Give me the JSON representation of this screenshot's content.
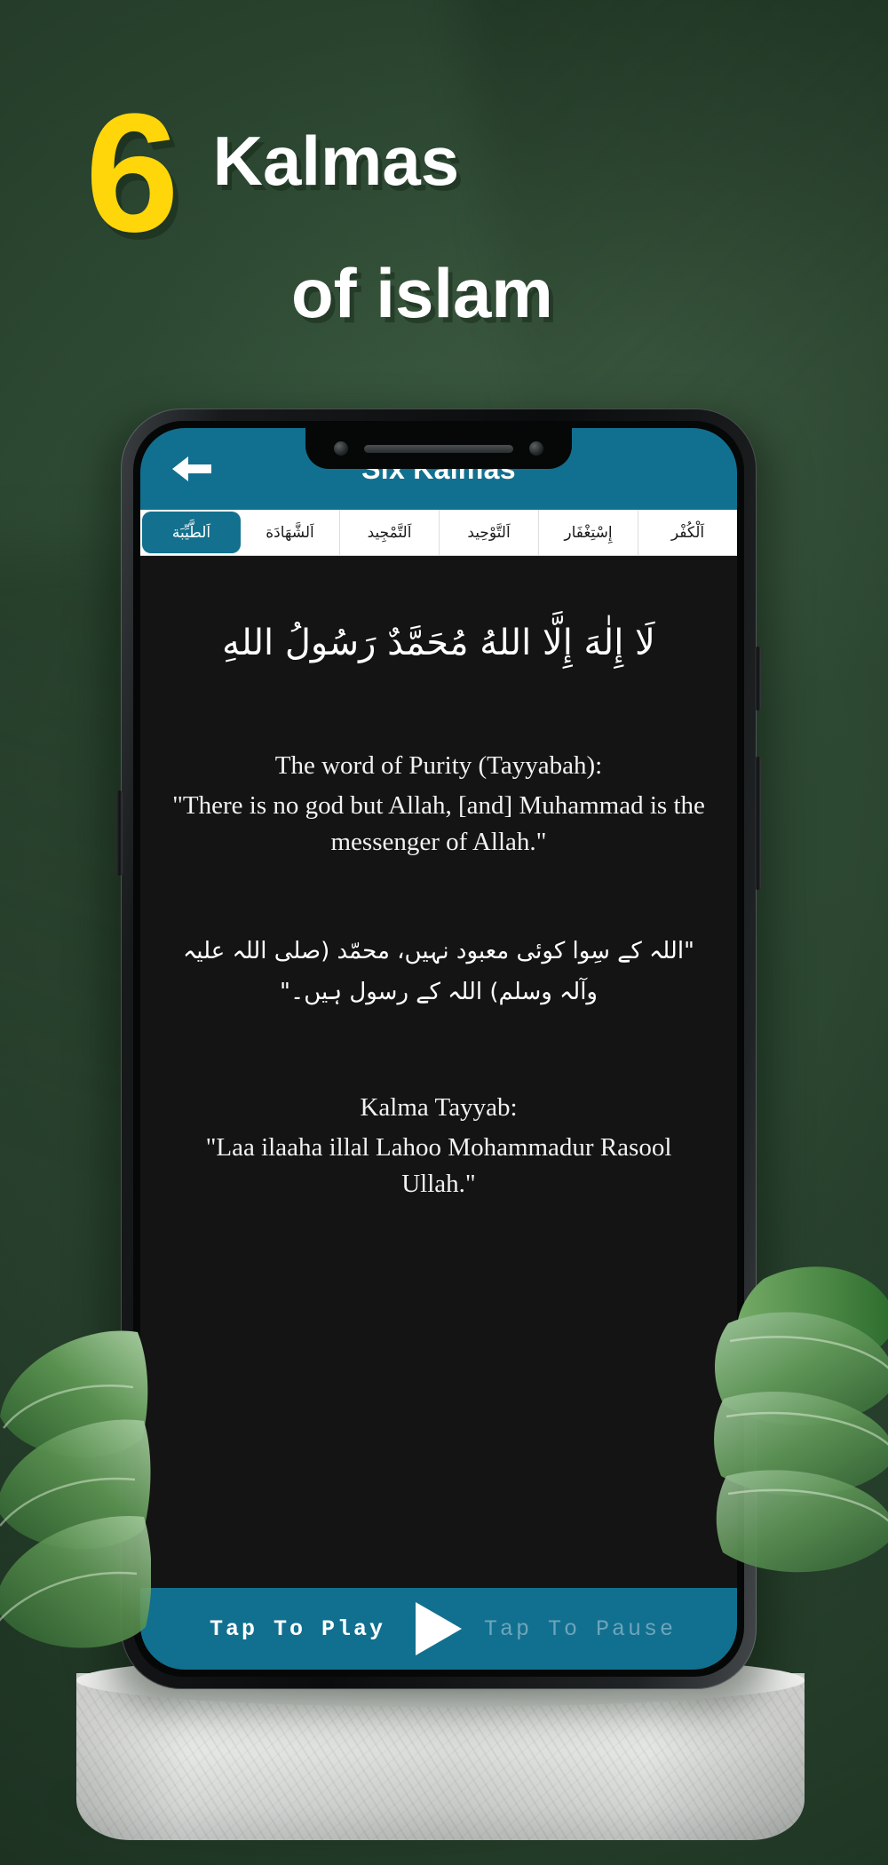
{
  "poster": {
    "big_number": "6",
    "title_line1": "Kalmas",
    "title_line2": "of islam",
    "number_color": "#FFD60A",
    "title_color": "#FFFFFF",
    "background_color": "#2F4A35"
  },
  "app": {
    "accent_color": "#11708F",
    "screen_background": "#141414",
    "appbar": {
      "title": "Six Kalmas",
      "back_icon": "arrow-left-icon"
    },
    "tabs": [
      {
        "label": "اَلطَّيِّبَة",
        "active": true
      },
      {
        "label": "اَلشَّهَادَة",
        "active": false
      },
      {
        "label": "اَلتَّمْجِيد",
        "active": false
      },
      {
        "label": "اَلتَّوْحِيد",
        "active": false
      },
      {
        "label": "إِسْتِغْفَار",
        "active": false
      },
      {
        "label": "اَلْكُفْر",
        "active": false
      }
    ],
    "content": {
      "arabic": "لَا إِلٰهَ إِلَّا اللهُ مُحَمَّدٌ رَسُولُ اللهِ",
      "english_heading": "The word of Purity (Tayyabah):",
      "english_body": "\"There is no god but Allah, [and] Muhammad is the messenger of Allah.\"",
      "urdu": "\"اللہ کے سِوا کوئی معبود نہیں، محمّد (صلی اللہ علیہ وآلہ وسلم) اللہ کے رسول ہیں۔\"",
      "translit_heading": "Kalma Tayyab:",
      "translit_body": "\"Laa ilaaha illal Lahoo Mohammadur Rasool Ullah.\""
    },
    "player": {
      "play_label": "Tap To Play",
      "play_icon": "play-triangle-icon",
      "pause_label": "Tap To Pause",
      "play_label_color": "#FFFFFF",
      "pause_label_color": "#6EA5BB"
    }
  }
}
